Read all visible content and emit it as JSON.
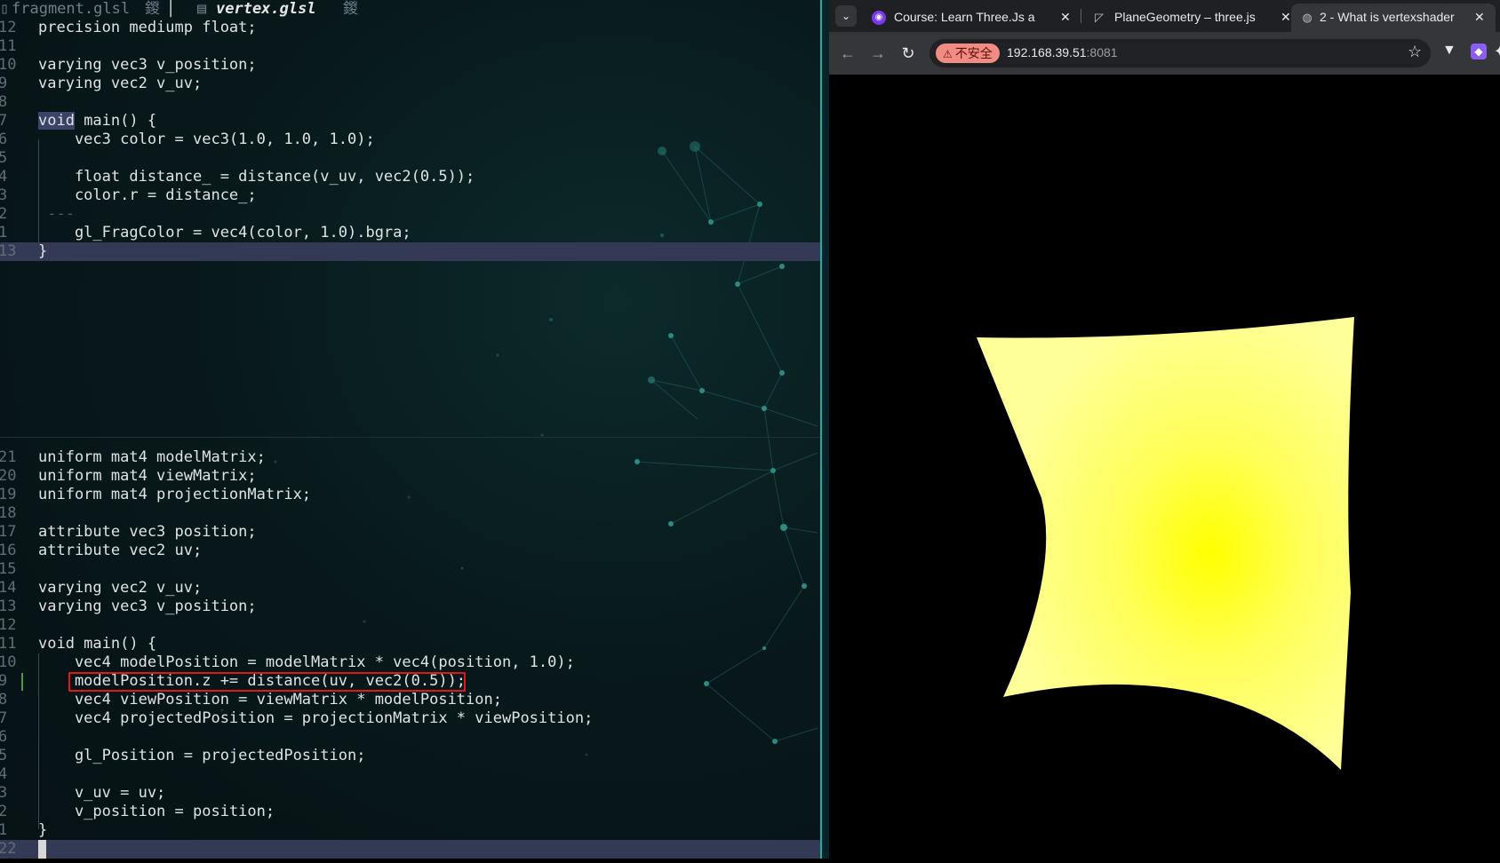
{
  "editor": {
    "tabs": [
      {
        "label": "fragment.glsl",
        "suffix": "鍐",
        "active": false
      },
      {
        "label": "vertex.glsl",
        "suffix": "鍐",
        "active": true
      }
    ],
    "top_pane": {
      "lines": [
        {
          "n": "12",
          "text": "precision mediump float;"
        },
        {
          "n": "11",
          "text": ""
        },
        {
          "n": "10",
          "text": "varying vec3 v_position;"
        },
        {
          "n": "9",
          "text": "varying vec2 v_uv;"
        },
        {
          "n": "8",
          "text": ""
        },
        {
          "n": "7",
          "text": "void main() {"
        },
        {
          "n": "6",
          "text": "    vec3 color = vec3(1.0, 1.0, 1.0);"
        },
        {
          "n": "5",
          "text": ""
        },
        {
          "n": "4",
          "text": "    float distance_ = distance(v_uv, vec2(0.5));"
        },
        {
          "n": "3",
          "text": "    color.r = distance_;"
        },
        {
          "n": "2",
          "text": " ---"
        },
        {
          "n": "1",
          "text": "    gl_FragColor = vec4(color, 1.0).bgra;"
        },
        {
          "n": "13",
          "text": "}"
        }
      ]
    },
    "bottom_pane": {
      "lines": [
        {
          "n": "21",
          "text": "uniform mat4 modelMatrix;"
        },
        {
          "n": "20",
          "text": "uniform mat4 viewMatrix;"
        },
        {
          "n": "19",
          "text": "uniform mat4 projectionMatrix;"
        },
        {
          "n": "18",
          "text": ""
        },
        {
          "n": "17",
          "text": "attribute vec3 position;"
        },
        {
          "n": "16",
          "text": "attribute vec2 uv;"
        },
        {
          "n": "15",
          "text": ""
        },
        {
          "n": "14",
          "text": "varying vec2 v_uv;"
        },
        {
          "n": "13",
          "text": "varying vec3 v_position;"
        },
        {
          "n": "12",
          "text": ""
        },
        {
          "n": "11",
          "text": "void main() {"
        },
        {
          "n": "10",
          "text": "    vec4 modelPosition = modelMatrix * vec4(position, 1.0);"
        },
        {
          "n": "9",
          "text": "    modelPosition.z += distance(uv, vec2(0.5));"
        },
        {
          "n": "8",
          "text": "    vec4 viewPosition = viewMatrix * modelPosition;"
        },
        {
          "n": "7",
          "text": "    vec4 projectedPosition = projectionMatrix * viewPosition;"
        },
        {
          "n": "6",
          "text": ""
        },
        {
          "n": "5",
          "text": "    gl_Position = projectedPosition;"
        },
        {
          "n": "4",
          "text": ""
        },
        {
          "n": "3",
          "text": "    v_uv = uv;"
        },
        {
          "n": "2",
          "text": "    v_position = position;"
        },
        {
          "n": "1",
          "text": "}"
        },
        {
          "n": "22",
          "text": ""
        }
      ]
    },
    "colors": {
      "highlight_box": "#e01818",
      "cursorline": "#343a55",
      "accent": "#2aa9a0"
    }
  },
  "browser": {
    "tabs": [
      {
        "title": "Course: Learn Three.Js a",
        "icon": "course-favicon",
        "active": false
      },
      {
        "title": "PlaneGeometry – three.js",
        "icon": "threejs-favicon",
        "active": false
      },
      {
        "title": "2 - What is vertexshader",
        "icon": "globe-favicon",
        "active": true
      }
    ],
    "toolbar": {
      "security_label": "不安全",
      "url_host": "192.168.39.51",
      "url_port": ":8081"
    },
    "scene": {
      "background": "#000000",
      "mesh_edge_color": "#ffff99",
      "mesh_center_color": "#ffff00"
    }
  }
}
